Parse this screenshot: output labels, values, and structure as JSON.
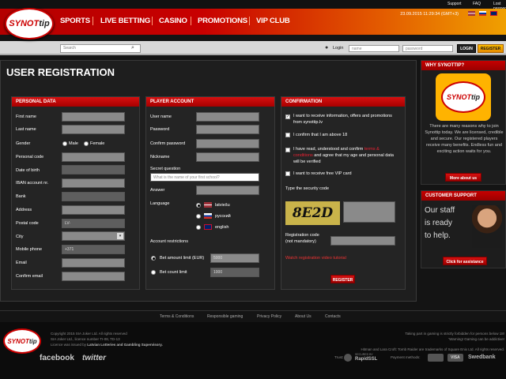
{
  "topbar": {
    "support": "Support",
    "faq": "FAQ",
    "lost_password": "Lost password?"
  },
  "brand": {
    "logo_main": "SYNOT",
    "logo_accent": "tip"
  },
  "nav": {
    "items": [
      "SPORTS",
      "LIVE BETTING",
      "CASINO",
      "PROMOTIONS",
      "VIP CLUB"
    ]
  },
  "header": {
    "datetime": "23.09.2015 11:29:34 (GMT+3)"
  },
  "searchbar": {
    "search_placeholder": "Search",
    "login_label": "Login",
    "name_placeholder": "name",
    "password_placeholder": "password",
    "login_button": "LOGIN",
    "register_button": "REGISTER"
  },
  "page": {
    "title": "USER REGISTRATION"
  },
  "personal": {
    "heading": "PERSONAL DATA",
    "labels": [
      "First name",
      "Last name",
      "Gender",
      "Personal code",
      "Date of birth",
      "IBAN account nr.",
      "Bank",
      "Address",
      "Postal code",
      "City",
      "Mobile phone",
      "Email",
      "Confirm email"
    ],
    "gender_male": "Male",
    "gender_female": "Female",
    "postal_value": "LV-",
    "phone_value": "+371"
  },
  "account": {
    "heading": "PLAYER ACCOUNT",
    "labels": {
      "username": "User name",
      "password": "Password",
      "confirm_password": "Confirm password",
      "nickname": "Nickname",
      "secret_question": "Secret question",
      "answer": "Answer",
      "language": "Language"
    },
    "secret_placeholder": "What is the name of your first school?",
    "languages": [
      "latviešu",
      "русский",
      "english"
    ],
    "restrictions": "Account restrictions",
    "limit_amount": "Bet amount limit (EUR)",
    "limit_amount_value": "5000",
    "limit_count": "Bet count limit",
    "limit_count_value": "1000"
  },
  "confirmation": {
    "heading": "CONFIRMATION",
    "check1": "I want to receive information, offers and promotions from synottip.lv",
    "check2": "I confirm that I am above 18",
    "check3_a": "I have read, understood and confirm ",
    "check3_link": "terms & conditions",
    "check3_b": " and agree that my age and personal data will be verified",
    "check4": "I want to receive free VIP card",
    "security_label": "Type the security code",
    "captcha": "8E2D",
    "reg_code": "Registration code",
    "reg_code_sub": "(not mandatory)",
    "video_link": "Watch registration video tutorial",
    "register_button": "REGISTER"
  },
  "side": {
    "why_heading": "WHY SYNOTTIP?",
    "why_text": "There are many reasons why to join Synottip today. We are licensed, credible and secure. Our registered players receive many benefits. Endless fun and exciting action waits for you.",
    "more": "More about us",
    "support_heading": "CUSTOMER SUPPORT",
    "support_text": "Our staff is ready to help.",
    "assist": "Click for assistance"
  },
  "footer_links": [
    "Terms & Conditions",
    "Responsible gaming",
    "Privacy Policy",
    "About Us",
    "Contacts"
  ],
  "footer": {
    "copyright1": "Copyright 2015 SIA Joker Ltd. All rights reserved",
    "copyright2": "SIA Joker Ltd., licence number TI-08, TD-13",
    "copyright3_a": "Licence was issued by ",
    "copyright3_b": "Latvian Lotteries and Gambling Supervisory.",
    "right1": "Taking part in gaming is strictly forbidden for persons below 18!",
    "right2": "'Warning! Gaming can be addictive!",
    "right3": "Hitman and Lara Croft: Tomb Raider are trademarks of Square Enix Ltd. All rights reserved.",
    "trust": "Trust:",
    "secured_by": "SECURED BY",
    "rapidssl": "RapidSSL",
    "payment": "Payment methods:",
    "pay_items": [
      "VISA",
      "Swedbank"
    ],
    "facebook": "facebook",
    "twitter": "twitter"
  },
  "colors": {
    "brand_red": "#c80000",
    "accent_orange": "#f0a000",
    "bg": "#141414"
  }
}
